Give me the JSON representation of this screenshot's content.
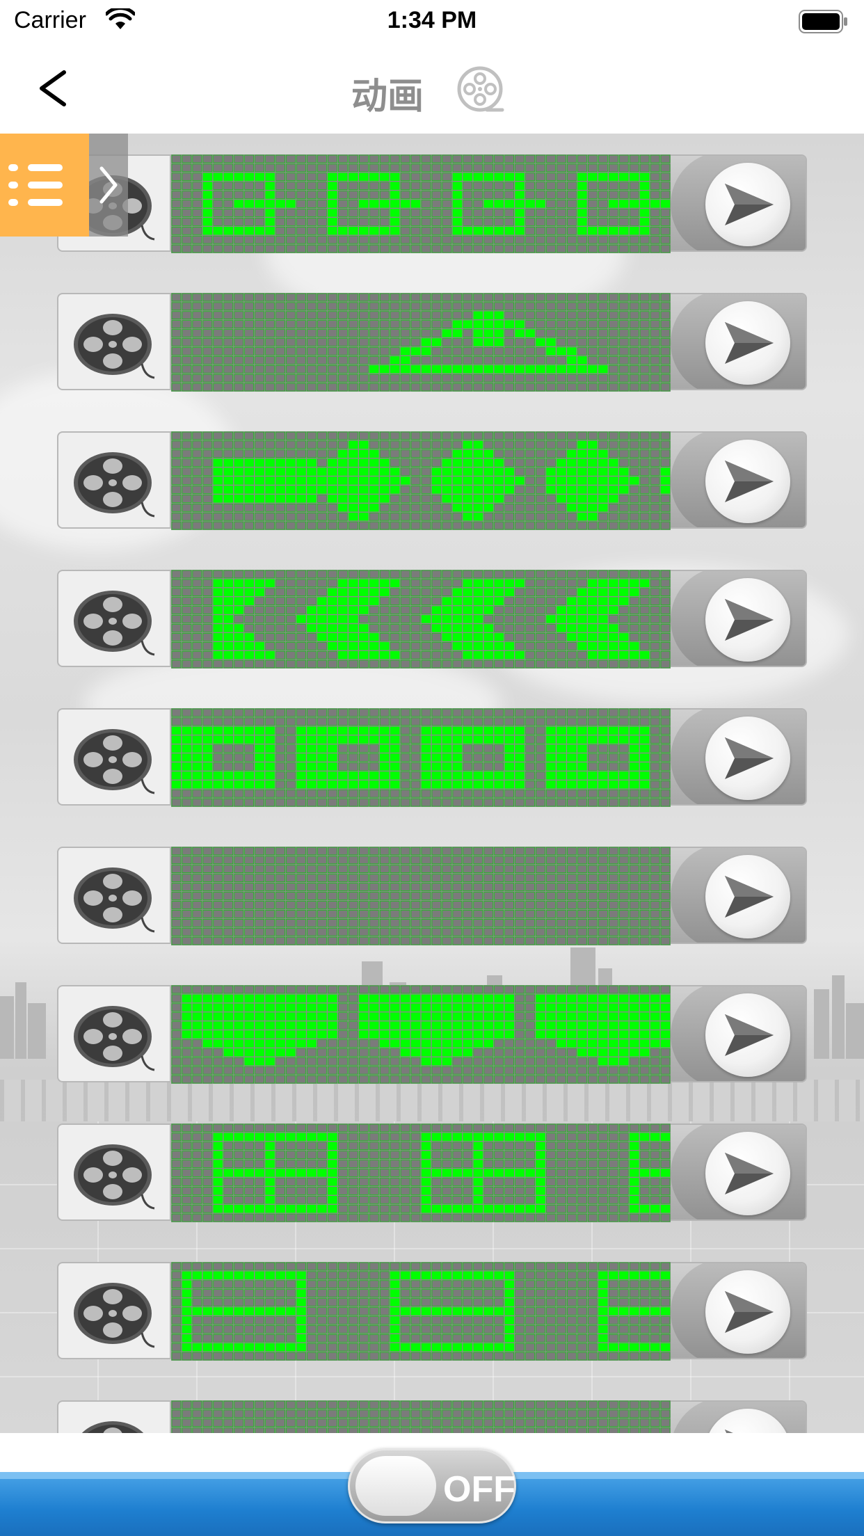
{
  "status_bar": {
    "carrier": "Carrier",
    "time": "1:34 PM"
  },
  "nav": {
    "title": "动画",
    "back_icon": "chevron-left-icon",
    "title_icon": "film-reel-icon"
  },
  "side_menu": {
    "icon": "list-menu-icon",
    "tab_icon": "chevron-right-icon",
    "accent": "#ffb54d"
  },
  "animations": [
    {
      "name": "animation-1"
    },
    {
      "name": "animation-2"
    },
    {
      "name": "animation-3"
    },
    {
      "name": "animation-4"
    },
    {
      "name": "animation-5"
    },
    {
      "name": "animation-6"
    },
    {
      "name": "animation-7"
    },
    {
      "name": "animation-8"
    },
    {
      "name": "animation-9"
    },
    {
      "name": "animation-10"
    }
  ],
  "colors": {
    "led_on": "#00ff00",
    "led_off": "#8a8a8a",
    "bottom_bar": "#1e7fd0"
  },
  "power_toggle": {
    "label": "OFF",
    "state": "off"
  }
}
